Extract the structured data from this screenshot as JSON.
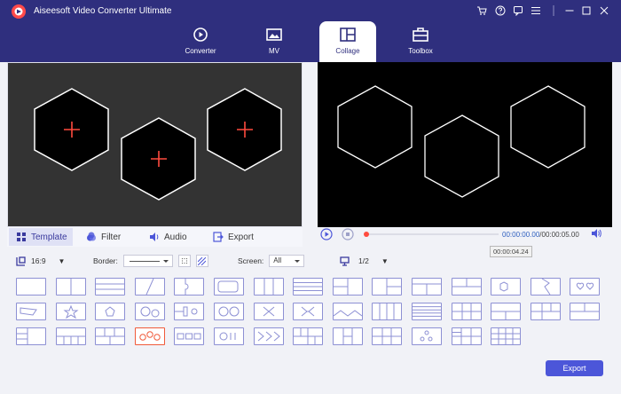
{
  "app": {
    "title": "Aiseesoft Video Converter Ultimate"
  },
  "top_tabs": [
    {
      "label": "Converter",
      "icon": "converter-icon"
    },
    {
      "label": "MV",
      "icon": "mv-icon"
    },
    {
      "label": "Collage",
      "icon": "collage-icon"
    },
    {
      "label": "Toolbox",
      "icon": "toolbox-icon"
    }
  ],
  "active_tab": "Collage",
  "window_icons": [
    "cart-icon",
    "support-icon",
    "chat-icon",
    "menu-icon",
    "minimize-icon",
    "maximize-icon",
    "close-icon"
  ],
  "sub_tabs": [
    "Template",
    "Filter",
    "Audio",
    "Export"
  ],
  "player": {
    "time_current": "00:00:00.00",
    "time_total": "00:00:05.00",
    "tooltip": "00:00:04.24",
    "progress": 0
  },
  "toolbar": {
    "aspect": "16:9",
    "border_label": "Border:",
    "screen_label": "Screen:",
    "screen_value": "All",
    "page": "1/2"
  },
  "templates": {
    "selected_index": 45,
    "count": 58
  },
  "buttons": {
    "export": "Export"
  },
  "colors": {
    "header": "#2f2f7e",
    "accent": "#4c56d9",
    "selected_template": "#f05a3a",
    "template_outline": "#8d90d4",
    "add_marker": "#ff4b3e"
  }
}
